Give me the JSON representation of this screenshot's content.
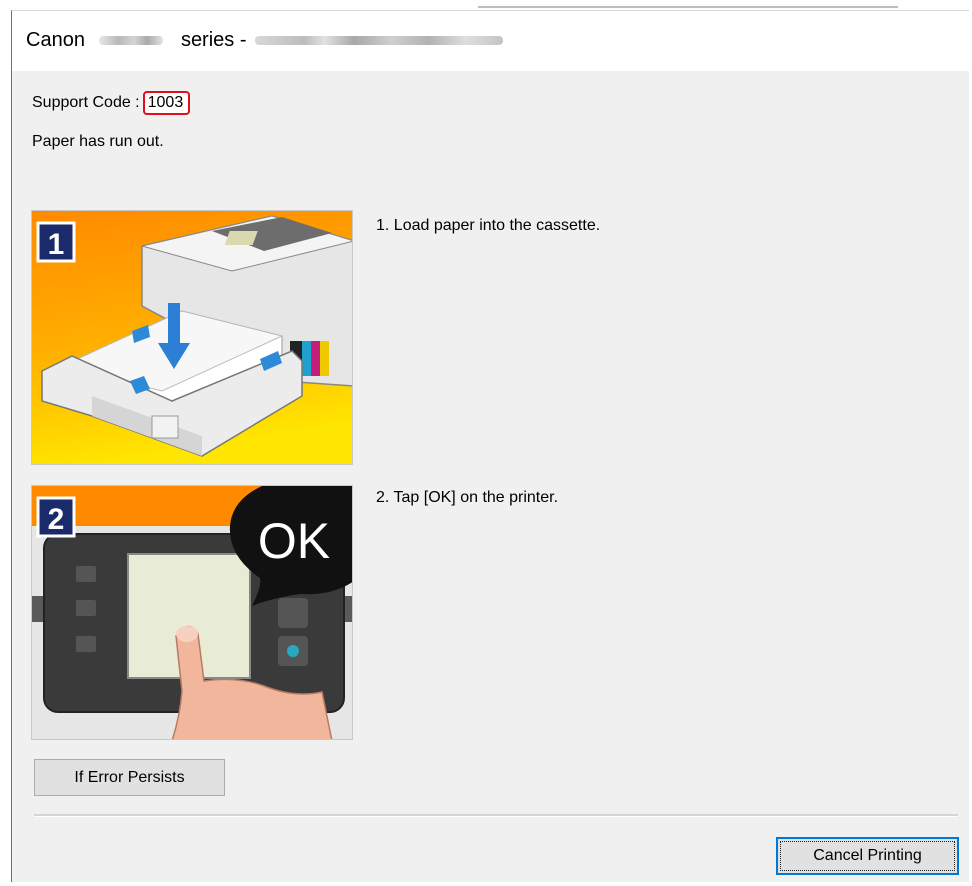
{
  "window": {
    "title_prefix": "Canon",
    "title_series": "series -"
  },
  "support": {
    "label": "Support Code :",
    "code": "1003"
  },
  "message": "Paper has run out.",
  "steps": [
    {
      "number": "1",
      "text": "1.  Load paper into the cassette."
    },
    {
      "number": "2",
      "text": "2.  Tap [OK] on the printer.",
      "callout": "OK"
    }
  ],
  "buttons": {
    "if_error_persists": "If Error Persists",
    "cancel_printing": "Cancel Printing"
  },
  "colors": {
    "highlight": "#e0101b",
    "focus": "#0078d7",
    "step_badge": "#1b2a6b",
    "step_bg_orange": "#ff8a00",
    "step_bg_yellow": "#ffe000"
  }
}
